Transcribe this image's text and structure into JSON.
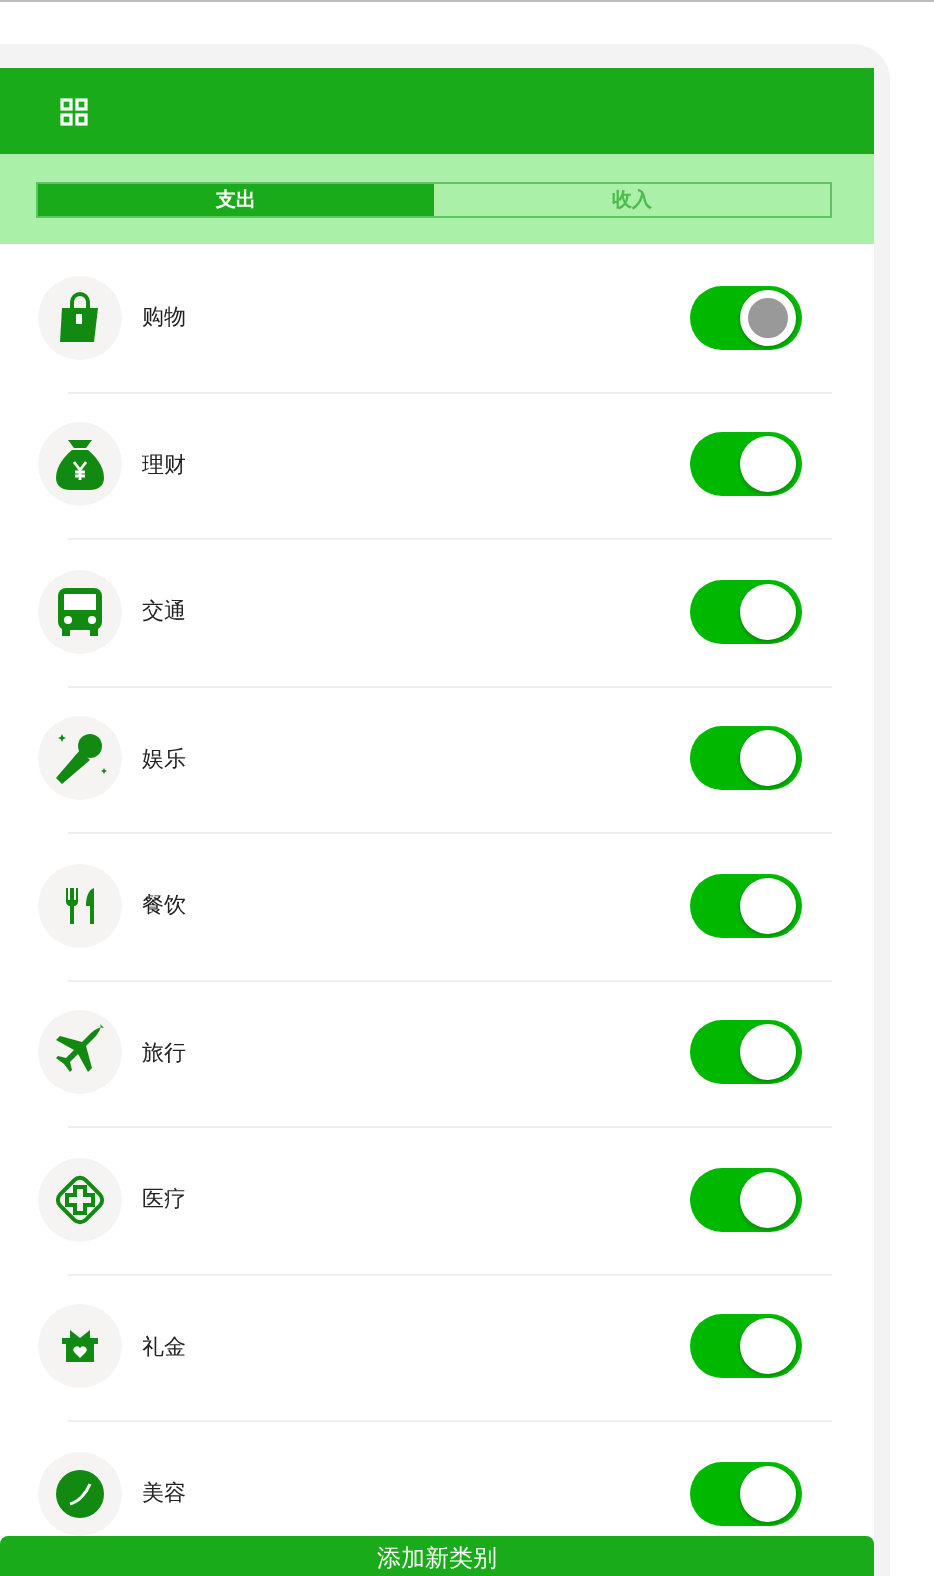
{
  "tabs": [
    {
      "label": "支出",
      "selected": true
    },
    {
      "label": "收入",
      "selected": false
    }
  ],
  "categories": [
    {
      "name": "购物",
      "kind": "bag",
      "on": true,
      "pressed": true
    },
    {
      "name": "理财",
      "kind": "money",
      "on": true,
      "pressed": false
    },
    {
      "name": "交通",
      "kind": "bus",
      "on": true,
      "pressed": false
    },
    {
      "name": "娱乐",
      "kind": "mic",
      "on": true,
      "pressed": false
    },
    {
      "name": "餐饮",
      "kind": "food",
      "on": true,
      "pressed": false
    },
    {
      "name": "旅行",
      "kind": "plane",
      "on": true,
      "pressed": false
    },
    {
      "name": "医疗",
      "kind": "medical",
      "on": true,
      "pressed": false
    },
    {
      "name": "礼金",
      "kind": "gift",
      "on": true,
      "pressed": false
    },
    {
      "name": "美容",
      "kind": "beauty",
      "on": true,
      "pressed": false
    }
  ],
  "add_button": "添加新类别"
}
